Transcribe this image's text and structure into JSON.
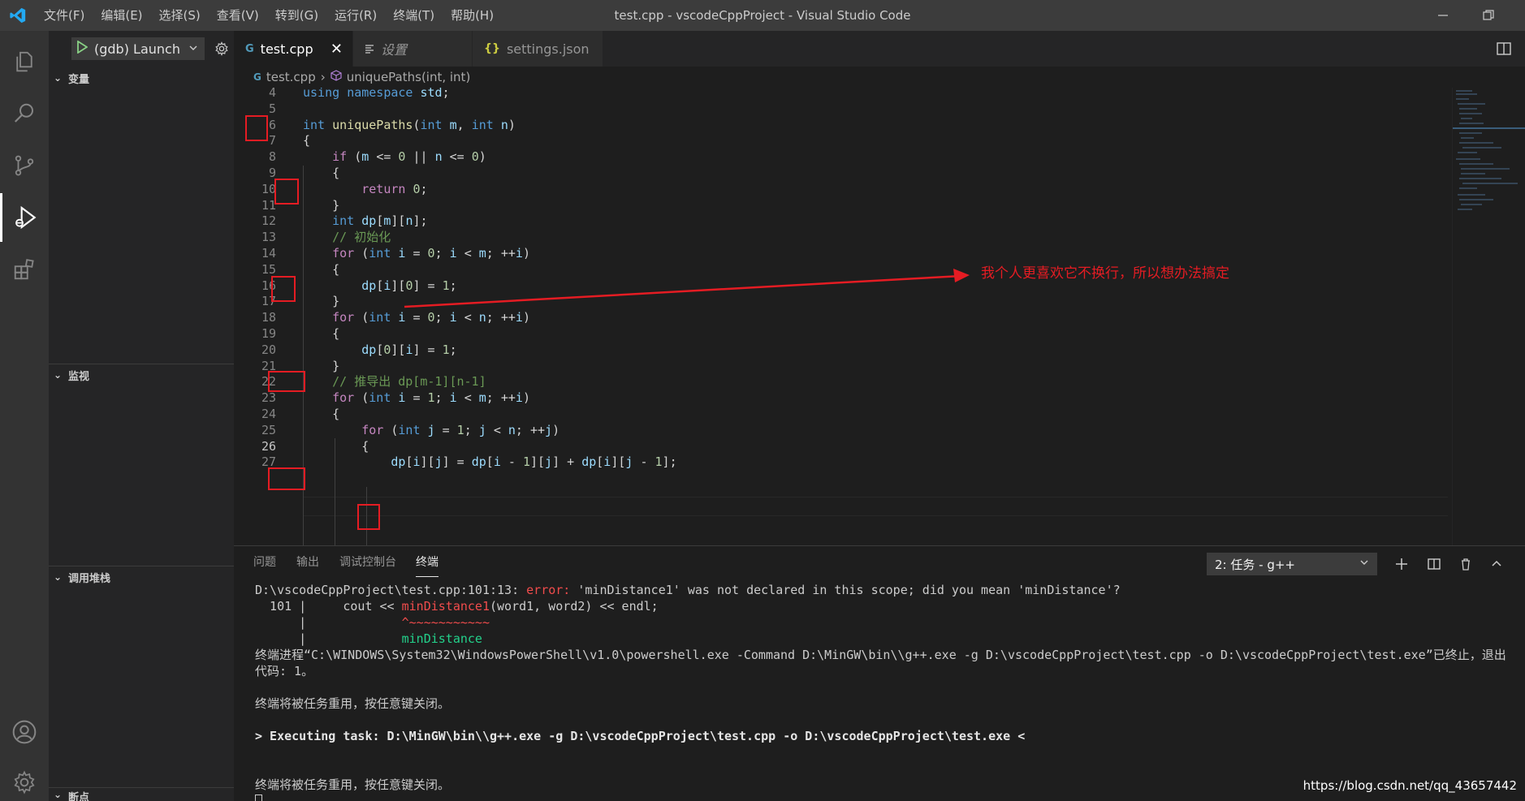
{
  "window": {
    "title": "test.cpp - vscodeCppProject - Visual Studio Code",
    "menu": [
      "文件(F)",
      "编辑(E)",
      "选择(S)",
      "查看(V)",
      "转到(G)",
      "运行(R)",
      "终端(T)",
      "帮助(H)"
    ]
  },
  "debug": {
    "config_label": "(gdb) Launch",
    "sections": [
      "变量",
      "监视",
      "调用堆栈",
      "断点"
    ]
  },
  "tabs": [
    {
      "label": "test.cpp",
      "icon": "cpp-file-icon"
    },
    {
      "label": "设置",
      "icon": "settings-list-icon"
    },
    {
      "label": "settings.json",
      "icon": "json-braces-icon"
    }
  ],
  "breadcrumb": {
    "file": "test.cpp",
    "symbol": "uniquePaths(int, int)"
  },
  "code_lines": [
    {
      "n": "4",
      "t": "using namespace std;"
    },
    {
      "n": "5",
      "t": ""
    },
    {
      "n": "6",
      "t": "int uniquePaths(int m, int n)"
    },
    {
      "n": "7",
      "t": "{"
    },
    {
      "n": "8",
      "t": "    if (m <= 0 || n <= 0)"
    },
    {
      "n": "9",
      "t": "    {"
    },
    {
      "n": "10",
      "t": "        return 0;"
    },
    {
      "n": "11",
      "t": "    }"
    },
    {
      "n": "12",
      "t": "    int dp[m][n];"
    },
    {
      "n": "13",
      "t": "    // 初始化"
    },
    {
      "n": "14",
      "t": "    for (int i = 0; i < m; ++i)"
    },
    {
      "n": "15",
      "t": "    {"
    },
    {
      "n": "16",
      "t": "        dp[i][0] = 1;"
    },
    {
      "n": "17",
      "t": "    }"
    },
    {
      "n": "18",
      "t": "    for (int i = 0; i < n; ++i)"
    },
    {
      "n": "19",
      "t": "    {"
    },
    {
      "n": "20",
      "t": "        dp[0][i] = 1;"
    },
    {
      "n": "21",
      "t": "    }"
    },
    {
      "n": "22",
      "t": "    // 推导出 dp[m-1][n-1]"
    },
    {
      "n": "23",
      "t": "    for (int i = 1; i < m; ++i)"
    },
    {
      "n": "24",
      "t": "    {"
    },
    {
      "n": "25",
      "t": "        for (int j = 1; j < n; ++j)"
    },
    {
      "n": "26",
      "t": "        {"
    },
    {
      "n": "27",
      "t": "            dp[i][j] = dp[i - 1][j] + dp[i][j - 1];"
    }
  ],
  "annotation": "我个人更喜欢它不换行，所以想办法搞定",
  "panel": {
    "tabs": [
      "问题",
      "输出",
      "调试控制台",
      "终端"
    ],
    "active_tab": "终端",
    "terminal_select": "2: 任务 - g++"
  },
  "terminal": {
    "l1_path": "D:\\vscodeCppProject\\test.cpp:101:13: ",
    "l1_err": "error:",
    "l1_msg": " 'minDistance1' was not declared in this scope; did you mean 'minDistance'?",
    "l2_pre": "  101 |     cout << ",
    "l2_err": "minDistance1",
    "l2_post": "(word1, word2) << endl;",
    "l3_pre": "      |             ",
    "l3_err": "^~~~~~~~~~~~",
    "l4_pre": "      |             ",
    "l4_grn": "minDistance",
    "l5": "终端进程“C:\\WINDOWS\\System32\\WindowsPowerShell\\v1.0\\powershell.exe -Command D:\\MinGW\\bin\\\\g++.exe -g D:\\vscodeCppProject\\test.cpp -o D:\\vscodeCppProject\\test.exe”已终止，退出",
    "l6": "代码: 1。",
    "l7": "终端将被任务重用，按任意键关闭。",
    "l8": "> Executing task: D:\\MinGW\\bin\\\\g++.exe -g D:\\vscodeCppProject\\test.cpp -o D:\\vscodeCppProject\\test.exe <",
    "l9": "终端将被任务重用，按任意键关闭。"
  },
  "watermark": "https://blog.csdn.net/qq_43657442",
  "colors": {
    "accent_red": "#e51c23",
    "titlebar": "#3c3c3c",
    "editor_bg": "#1e1e1e"
  }
}
